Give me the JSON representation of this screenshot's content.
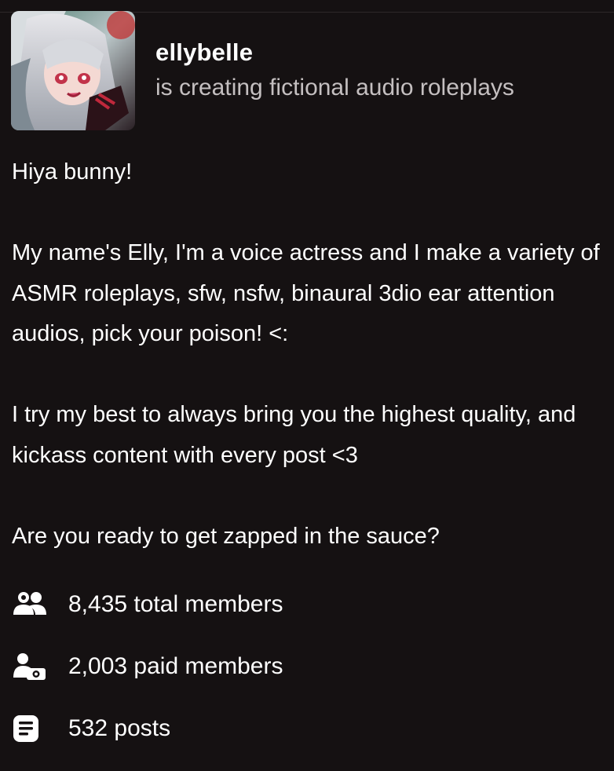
{
  "creator": {
    "name": "ellybelle",
    "tagline": "is creating fictional audio roleplays",
    "avatar_alt": "anime girl avatar"
  },
  "bio": {
    "paragraphs": [
      "Hiya bunny!",
      "My name's Elly, I'm a voice actress and I make a variety of ASMR roleplays, sfw, nsfw, binaural 3dio ear attention audios, pick your poison! <:",
      "I try my best to always bring you the highest quality, and kickass content with every post <3",
      "Are you ready to get zapped in the sauce?"
    ]
  },
  "stats": {
    "total_members": "8,435 total members",
    "paid_members": "2,003 paid members",
    "posts": "532 posts"
  },
  "icons": {
    "total_members": "people-icon",
    "paid_members": "paid-member-icon",
    "posts": "posts-icon"
  },
  "colors": {
    "background": "#151112",
    "text": "#ffffff",
    "muted": "#c4bfc0"
  }
}
